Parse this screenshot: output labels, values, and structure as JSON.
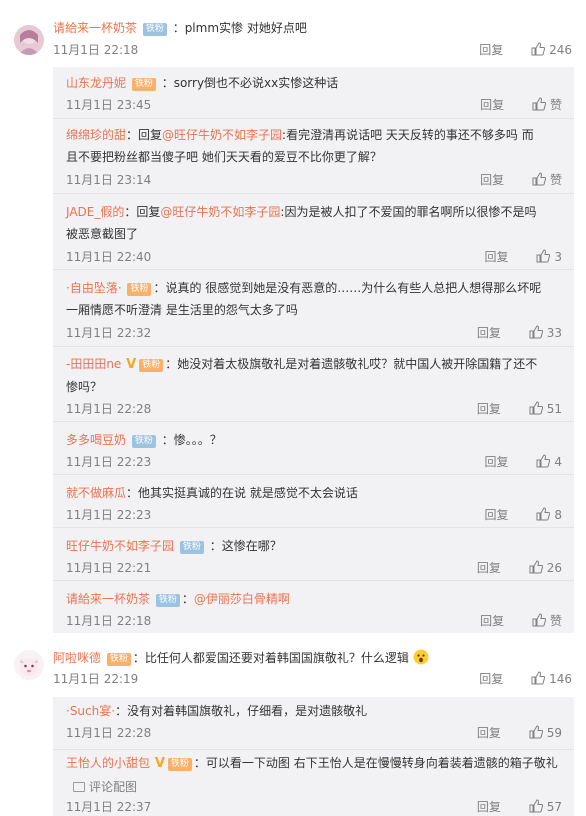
{
  "comments": [
    {
      "user": "请給来一杯奶茶",
      "badge": "铁粉",
      "text": "：plmm实惨 对她好点吧",
      "time": "11月1日 22:18",
      "reply": "回复",
      "likes": "246"
    },
    {
      "user": "阿啦咪德",
      "badge": "铁粉",
      "text": "：比任何人都爱国还要对着韩国国旗敬礼？什么逻辑",
      "time": "11月1日 22:19",
      "reply": "回复",
      "likes": "146"
    }
  ],
  "replies_group1": [
    {
      "user": "山东龙丹妮",
      "badge": "铁粉",
      "text": "：sorry倒也不必说xx实惨这种话",
      "time": "11月1日 23:45",
      "reply": "回复",
      "likes": "赞"
    },
    {
      "user": "绵绵珍的甜",
      "text_a": "：回复",
      "mention": "@旺仔牛奶不如李子园",
      "text_b": ":看完澄清再说话吧 天天反转的事还不够多吗 而且不要把粉丝都当傻子吧 她们天天看的爱豆不比你更了解？",
      "time": "11月1日 23:14",
      "reply": "回复",
      "likes": "赞"
    },
    {
      "user": "JADE_假的",
      "text_a": "：回复",
      "mention": "@旺仔牛奶不如李子园",
      "text_b": ":因为是被人扣了不爱国的罪名啊所以很惨不是吗被恶意截图了",
      "time": "11月1日 22:40",
      "reply": "回复",
      "likes": "3"
    },
    {
      "user": "·自由坠落·",
      "badge": "铁粉",
      "text": "：说真的 很感觉到她是没有恶意的……为什么有些人总把人想得那么坏呢 一厢情愿不听澄清 是生活里的怨气太多了吗",
      "time": "11月1日 22:32",
      "reply": "回复",
      "likes": "33"
    },
    {
      "user": "-田田田ne",
      "badge": "铁粉",
      "text": "：她没对着太极旗敬礼是对着遗骸敬礼哎？就中国人被开除国籍了还不惨吗？",
      "time": "11月1日 22:28",
      "reply": "回复",
      "likes": "51"
    },
    {
      "user": "多多喝豆奶",
      "badge": "铁粉",
      "text": "：惨。。。？",
      "time": "11月1日 22:23",
      "reply": "回复",
      "likes": "4"
    },
    {
      "user": "就不做麻瓜",
      "text": "：他其实挺真诚的在说 就是感觉不太会说话",
      "time": "11月1日 22:23",
      "reply": "回复",
      "likes": "8"
    },
    {
      "user": "旺仔牛奶不如李子园",
      "badge": "铁粉",
      "text": "：这惨在哪？",
      "time": "11月1日 22:21",
      "reply": "回复",
      "likes": "26"
    },
    {
      "user": "请給来一杯奶茶",
      "badge": "铁粉",
      "text": "：",
      "mention": "@伊丽莎白骨精啊",
      "time": "11月1日 22:18",
      "reply": "回复",
      "likes": "赞"
    }
  ],
  "replies_group2": [
    {
      "user": "·Such宴·",
      "text": "：没有对着韩国旗敬礼，仔细看，是对遗骸敬礼",
      "time": "11月1日 22:28",
      "reply": "回复",
      "likes": "59"
    },
    {
      "user": "王怡人的小甜包",
      "badge": "铁粉",
      "text": "：可以看一下动图 右下王怡人是在慢慢转身向着装着遗骸的箱子敬礼",
      "pic_link": "评论配图",
      "time": "11月1日 22:37",
      "reply": "回复",
      "likes": "57"
    }
  ],
  "icons": {
    "like": "thumbs-up-icon",
    "vip": "v-badge-icon",
    "fan_level": "fan-level-icon",
    "emoji": "surprised-emoji-icon",
    "picture": "picture-icon"
  },
  "colors": {
    "username": "#eb7350",
    "reply_bg": "#f2f2f5",
    "meta": "#808080"
  }
}
